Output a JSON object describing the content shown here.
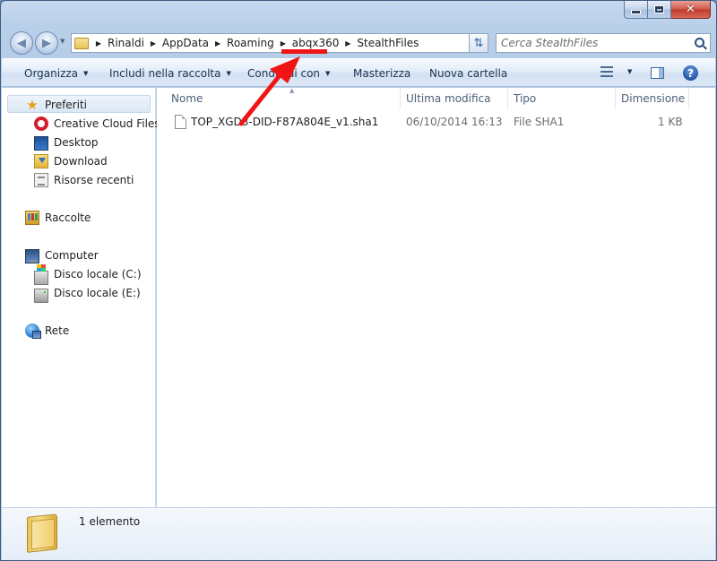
{
  "window": {
    "caption_minimize": "–",
    "caption_maximize": "□",
    "caption_close": "✕"
  },
  "navigation": {
    "back_icon": "arrow-left-icon",
    "forward_icon": "arrow-right-icon"
  },
  "address_bar": {
    "breadcrumbs": [
      "Rinaldi",
      "AppData",
      "Roaming",
      "abqx360",
      "StealthFiles"
    ]
  },
  "search": {
    "placeholder": "Cerca StealthFiles",
    "value": ""
  },
  "toolbar": {
    "organize": "Organizza",
    "include_in_library": "Includi nella raccolta",
    "share_with": "Condividi con",
    "burn": "Masterizza",
    "new_folder": "Nuova cartella"
  },
  "sidebar": {
    "favorites": {
      "label": "Preferiti",
      "items": [
        "Creative Cloud Files",
        "Desktop",
        "Download",
        "Risorse recenti"
      ]
    },
    "libraries": {
      "label": "Raccolte"
    },
    "computer": {
      "label": "Computer",
      "items": [
        "Disco locale (C:)",
        "Disco locale (E:)"
      ]
    },
    "network": {
      "label": "Rete"
    }
  },
  "file_list": {
    "columns": {
      "name": "Nome",
      "modified": "Ultima modifica",
      "type": "Tipo",
      "size": "Dimensione"
    },
    "rows": [
      {
        "name": "TOP_XGD3-DID-F87A804E_v1.sha1",
        "modified": "06/10/2014 16:13",
        "type": "File SHA1",
        "size": "1 KB"
      }
    ]
  },
  "status": {
    "count": "1 elemento"
  },
  "colors": {
    "annotation": "#f01414",
    "accent": "#2a62aa"
  }
}
